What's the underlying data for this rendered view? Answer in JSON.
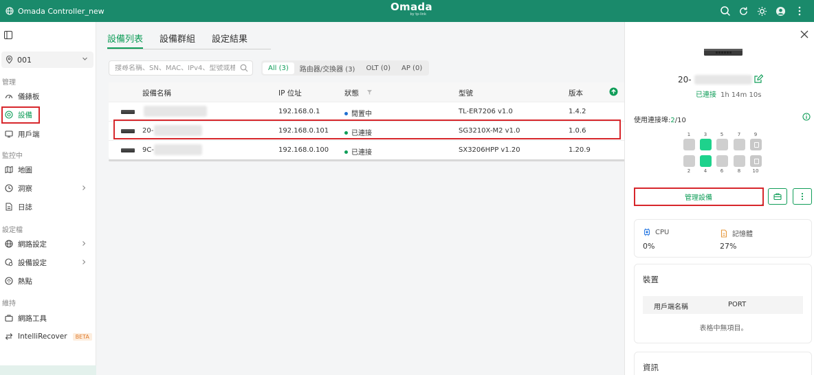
{
  "app": {
    "title": "Omada Controller_new",
    "logo": "Omada",
    "logo_sub": "by tp-link"
  },
  "topbar": {
    "icons": [
      "search-icon",
      "refresh-icon",
      "theme-icon",
      "avatar",
      "more-icon"
    ]
  },
  "sidebar": {
    "site": "001",
    "sections": {
      "manage": "管理",
      "monitor": "監控中",
      "config": "設定檔",
      "maintain": "維持"
    },
    "items": {
      "dashboard": "儀錶板",
      "devices": "設備",
      "clients": "用戶端",
      "map": "地圖",
      "insight": "洞察",
      "logs": "日誌",
      "network_settings": "網路設定",
      "device_settings": "設備設定",
      "hotspot": "熱點",
      "network_tools": "網路工具",
      "intellirecover": "IntelliRecover",
      "beta": "BETA"
    }
  },
  "main": {
    "tabs": [
      "設備列表",
      "設備群組",
      "設定結果"
    ],
    "search_placeholder": "搜尋名稱、SN、MAC、IPv4、型號或標籤",
    "filters": [
      "All (3)",
      "路由器/交換器 (3)",
      "OLT (0)",
      "AP (0)"
    ],
    "columns": {
      "name": "設備名稱",
      "ip": "IP 位址",
      "status": "狀態",
      "model": "型號",
      "version": "版本"
    },
    "rows": [
      {
        "name": "",
        "ip": "192.168.0.1",
        "status": "閒置中",
        "status_color": "#1f6fd1",
        "model": "TL-ER7206 v1.0",
        "version": "1.4.2"
      },
      {
        "name": "20-",
        "ip": "192.168.0.101",
        "status": "已連接",
        "status_color": "#0f9d58",
        "model": "SG3210X-M2 v1.0",
        "version": "1.0.6"
      },
      {
        "name": "9C-",
        "ip": "192.168.0.100",
        "status": "已連接",
        "status_color": "#0f9d58",
        "model": "SX3206HPP v1.20",
        "version": "1.20.9"
      }
    ]
  },
  "panel": {
    "device_name": "20-",
    "status": "已連接",
    "uptime": "1h 14m 10s",
    "ports_label": "使用連接埠:",
    "ports_used": "2",
    "ports_total": "/10",
    "ports_top": [
      "1",
      "3",
      "5",
      "7",
      "9"
    ],
    "ports_bottom": [
      "2",
      "4",
      "6",
      "8",
      "10"
    ],
    "manage_button": "管理設備",
    "cpu_label": "CPU",
    "cpu_value": "0%",
    "memory_label": "記憶體",
    "memory_value": "27%",
    "clients_title": "裝置",
    "clients_col_name": "用戶端名稱",
    "clients_col_port": "PORT",
    "clients_empty": "表格中無項目。",
    "info_title": "資訊"
  }
}
